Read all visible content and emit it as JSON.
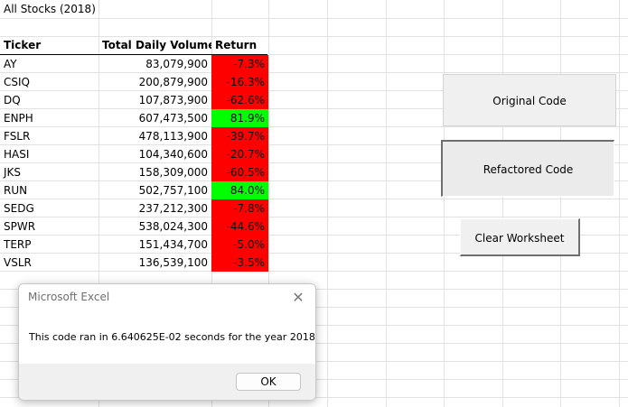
{
  "sheet": {
    "title": "All Stocks (2018)",
    "headers": {
      "ticker": "Ticker",
      "volume": "Total Daily Volume",
      "return": "Return"
    },
    "rows": [
      {
        "ticker": "AY",
        "volume": "83,079,900",
        "return": "-7.3%",
        "status": "negative"
      },
      {
        "ticker": "CSIQ",
        "volume": "200,879,900",
        "return": "-16.3%",
        "status": "negative"
      },
      {
        "ticker": "DQ",
        "volume": "107,873,900",
        "return": "-62.6%",
        "status": "negative"
      },
      {
        "ticker": "ENPH",
        "volume": "607,473,500",
        "return": "81.9%",
        "status": "positive"
      },
      {
        "ticker": "FSLR",
        "volume": "478,113,900",
        "return": "-39.7%",
        "status": "negative"
      },
      {
        "ticker": "HASI",
        "volume": "104,340,600",
        "return": "-20.7%",
        "status": "negative"
      },
      {
        "ticker": "JKS",
        "volume": "158,309,000",
        "return": "-60.5%",
        "status": "negative"
      },
      {
        "ticker": "RUN",
        "volume": "502,757,100",
        "return": "84.0%",
        "status": "positive"
      },
      {
        "ticker": "SEDG",
        "volume": "237,212,300",
        "return": "-7.8%",
        "status": "negative"
      },
      {
        "ticker": "SPWR",
        "volume": "538,024,300",
        "return": "-44.6%",
        "status": "negative"
      },
      {
        "ticker": "TERP",
        "volume": "151,434,700",
        "return": "-5.0%",
        "status": "negative"
      },
      {
        "ticker": "VSLR",
        "volume": "136,539,100",
        "return": "-3.5%",
        "status": "negative"
      }
    ]
  },
  "buttons": {
    "original": "Original Code",
    "refactored": "Refactored Code",
    "clear": "Clear Worksheet"
  },
  "dialog": {
    "title": "Microsoft Excel",
    "message": "This code ran in 6.640625E-02 seconds for the year 2018",
    "ok_label": "OK"
  },
  "colors": {
    "positive": "#00ff00",
    "negative": "#ff0000",
    "gridline": "#e1e1e1",
    "button_face": "#f0f0f0"
  },
  "icons": {
    "close": "close-icon"
  }
}
